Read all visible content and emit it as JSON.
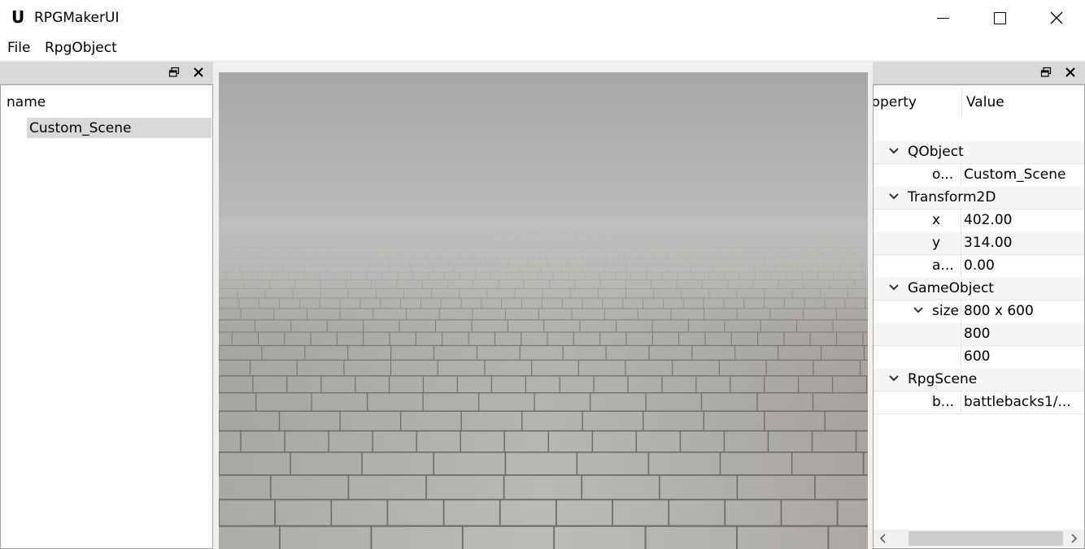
{
  "window": {
    "logo": "U",
    "title": "RPGMakerUI"
  },
  "menu": {
    "file": "File",
    "rpgobject": "RpgObject"
  },
  "scene_tree": {
    "header": "name",
    "items": [
      {
        "label": "Custom_Scene",
        "selected": true
      }
    ]
  },
  "property_panel": {
    "col_property": "roperty",
    "col_value": "Value",
    "rows": [
      {
        "name": "QObject",
        "value": ""
      },
      {
        "name": "o...",
        "value": "Custom_Scene"
      },
      {
        "name": "Transform2D",
        "value": ""
      },
      {
        "name": "x",
        "value": "402.00"
      },
      {
        "name": "y",
        "value": "314.00"
      },
      {
        "name": "a...",
        "value": "0.00"
      },
      {
        "name": "GameObject",
        "value": ""
      },
      {
        "name": "size",
        "value": "800 x 600"
      },
      {
        "name": "",
        "value": "800"
      },
      {
        "name": "",
        "value": "600"
      },
      {
        "name": "RpgScene",
        "value": ""
      },
      {
        "name": "b...",
        "value": "battlebacks1/..."
      }
    ]
  },
  "icons": {
    "float": "float-icon",
    "close": "close-icon",
    "chevron": "chevron-down-icon"
  },
  "colors": {
    "selection": "#d9d9d9",
    "dock_header": "#d9d9d9",
    "border": "#a0a0a0"
  }
}
